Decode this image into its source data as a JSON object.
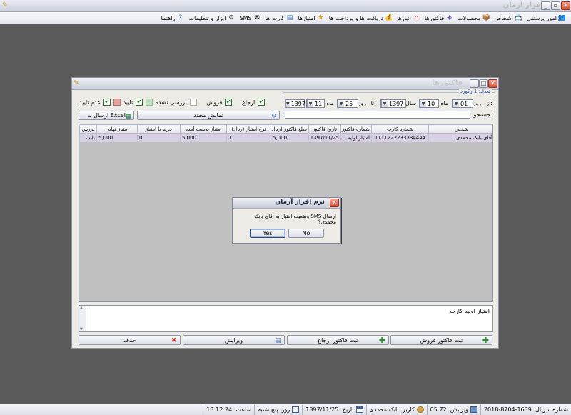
{
  "app": {
    "title": "نرم افزار آرمان"
  },
  "menu": [
    {
      "label": "امور پرسنلی",
      "icon": "people-icon"
    },
    {
      "label": "اشخاص",
      "icon": "contacts-icon"
    },
    {
      "label": "محصولات",
      "icon": "box-icon"
    },
    {
      "label": "فاکتورها",
      "icon": "invoice-icon"
    },
    {
      "label": "انبارها",
      "icon": "warehouse-icon"
    },
    {
      "label": "دریافت ها و پرداخت ها",
      "icon": "money-bag-icon"
    },
    {
      "label": "امتیازها",
      "icon": "star-icon"
    },
    {
      "label": "کارت ها",
      "icon": "card-icon"
    },
    {
      "label": "SMS",
      "icon": "sms-icon"
    },
    {
      "label": "ابزار و تنظیمات",
      "icon": "tools-icon"
    },
    {
      "label": "راهنما",
      "icon": "help-icon"
    }
  ],
  "invoices_window": {
    "title": "فاکتورها",
    "filters": {
      "return_label": "ارجاع",
      "sales_label": "فروش",
      "unreviewed_label": "بررسی نشده",
      "approve_label": "تایید",
      "not_approved_label": "عدم تایید"
    },
    "count_text": "تعداد: 1 رکورد",
    "from_label": "از:",
    "to_label": "تا:",
    "day_label": "روز",
    "month_label": "ماه",
    "year_label": "سال",
    "from_day": "01",
    "from_month": "10",
    "from_year": "1397",
    "to_day": "25",
    "to_month": "11",
    "to_year": "1397",
    "search_label": "جستجو:",
    "search_value": "",
    "refresh_label": "نمایش مجدد",
    "excel_label": "ارسال به Excel",
    "columns": [
      "شخص",
      "شماره کارت",
      "شماره فاکتور",
      "تاریخ فاکتور",
      "مبلغ فاکتور (ریال)",
      "نرخ امتیاز (ریال)",
      "امتیاز بدست آمده",
      "خرید با امتیاز",
      "امتیاز نهایی",
      "بررس"
    ],
    "rows": [
      [
        "آقای بابک محمدی",
        "1111222233334444",
        "امتیاز اولیه ...",
        "1397/11/25",
        "5,000",
        "1",
        "5,000",
        "0",
        "5,000",
        "بابک"
      ]
    ],
    "note_text": "امتیاز اولیه کارت",
    "buttons": {
      "sales_invoice": "ثبت فاکتور فروش",
      "return_invoice": "ثبت فاکتور ارجاع",
      "edit": "ویرایش",
      "delete": "حذف"
    }
  },
  "dialog": {
    "title": "نرم افزار آرمان",
    "message": "ارسال SMS وضعیت امتیاز به آقای بابک محمدی؟",
    "yes": "Yes",
    "no": "No"
  },
  "status": {
    "serial": "شماره سریال: 1639-8704-2018",
    "version": "ویرایش: 05.72",
    "user": "کاربر: بابک محمدی",
    "date": "تاریخ: 1397/11/25",
    "weekday": "روز: پنج شنبه",
    "time": "ساعت: 13:12:24"
  },
  "colors": {
    "desktop": "#5a5a5a",
    "selected_row": "#d9cfe2",
    "close_red": "#d3513a",
    "accent_green": "#2e8b2e"
  }
}
